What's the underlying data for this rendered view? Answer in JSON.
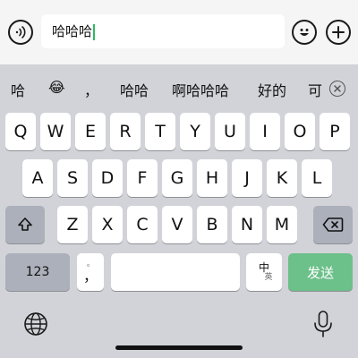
{
  "input_bar": {
    "text": "哈哈哈",
    "voice_icon": "voice-icon",
    "emoji_icon": "emoji-icon",
    "plus_icon": "plus-icon"
  },
  "candidates": {
    "items": [
      "哈",
      "😂",
      "，",
      "哈哈",
      "啊哈哈哈",
      "好的",
      "可"
    ],
    "close_icon": "close-icon"
  },
  "keyboard": {
    "row1": [
      "Q",
      "W",
      "E",
      "R",
      "T",
      "Y",
      "U",
      "I",
      "O",
      "P"
    ],
    "row2": [
      "A",
      "S",
      "D",
      "F",
      "G",
      "H",
      "J",
      "K",
      "L"
    ],
    "row3": [
      "Z",
      "X",
      "C",
      "V",
      "B",
      "N",
      "M"
    ],
    "shift_icon": "shift-icon",
    "delete_icon": "delete-icon",
    "numbers_label": "123",
    "punct_small": "。",
    "punct_main": "，",
    "lang_cn": "中",
    "lang_en": "英",
    "send_label": "发送",
    "globe_icon": "globe-icon",
    "mic_icon": "microphone-icon"
  },
  "colors": {
    "keyboard_bg": "#d2d3d8",
    "key_bg": "#ffffff",
    "dark_key_bg": "#abb0ba",
    "send_bg": "#6cc08a",
    "input_bar_bg": "#f5f5f5"
  }
}
